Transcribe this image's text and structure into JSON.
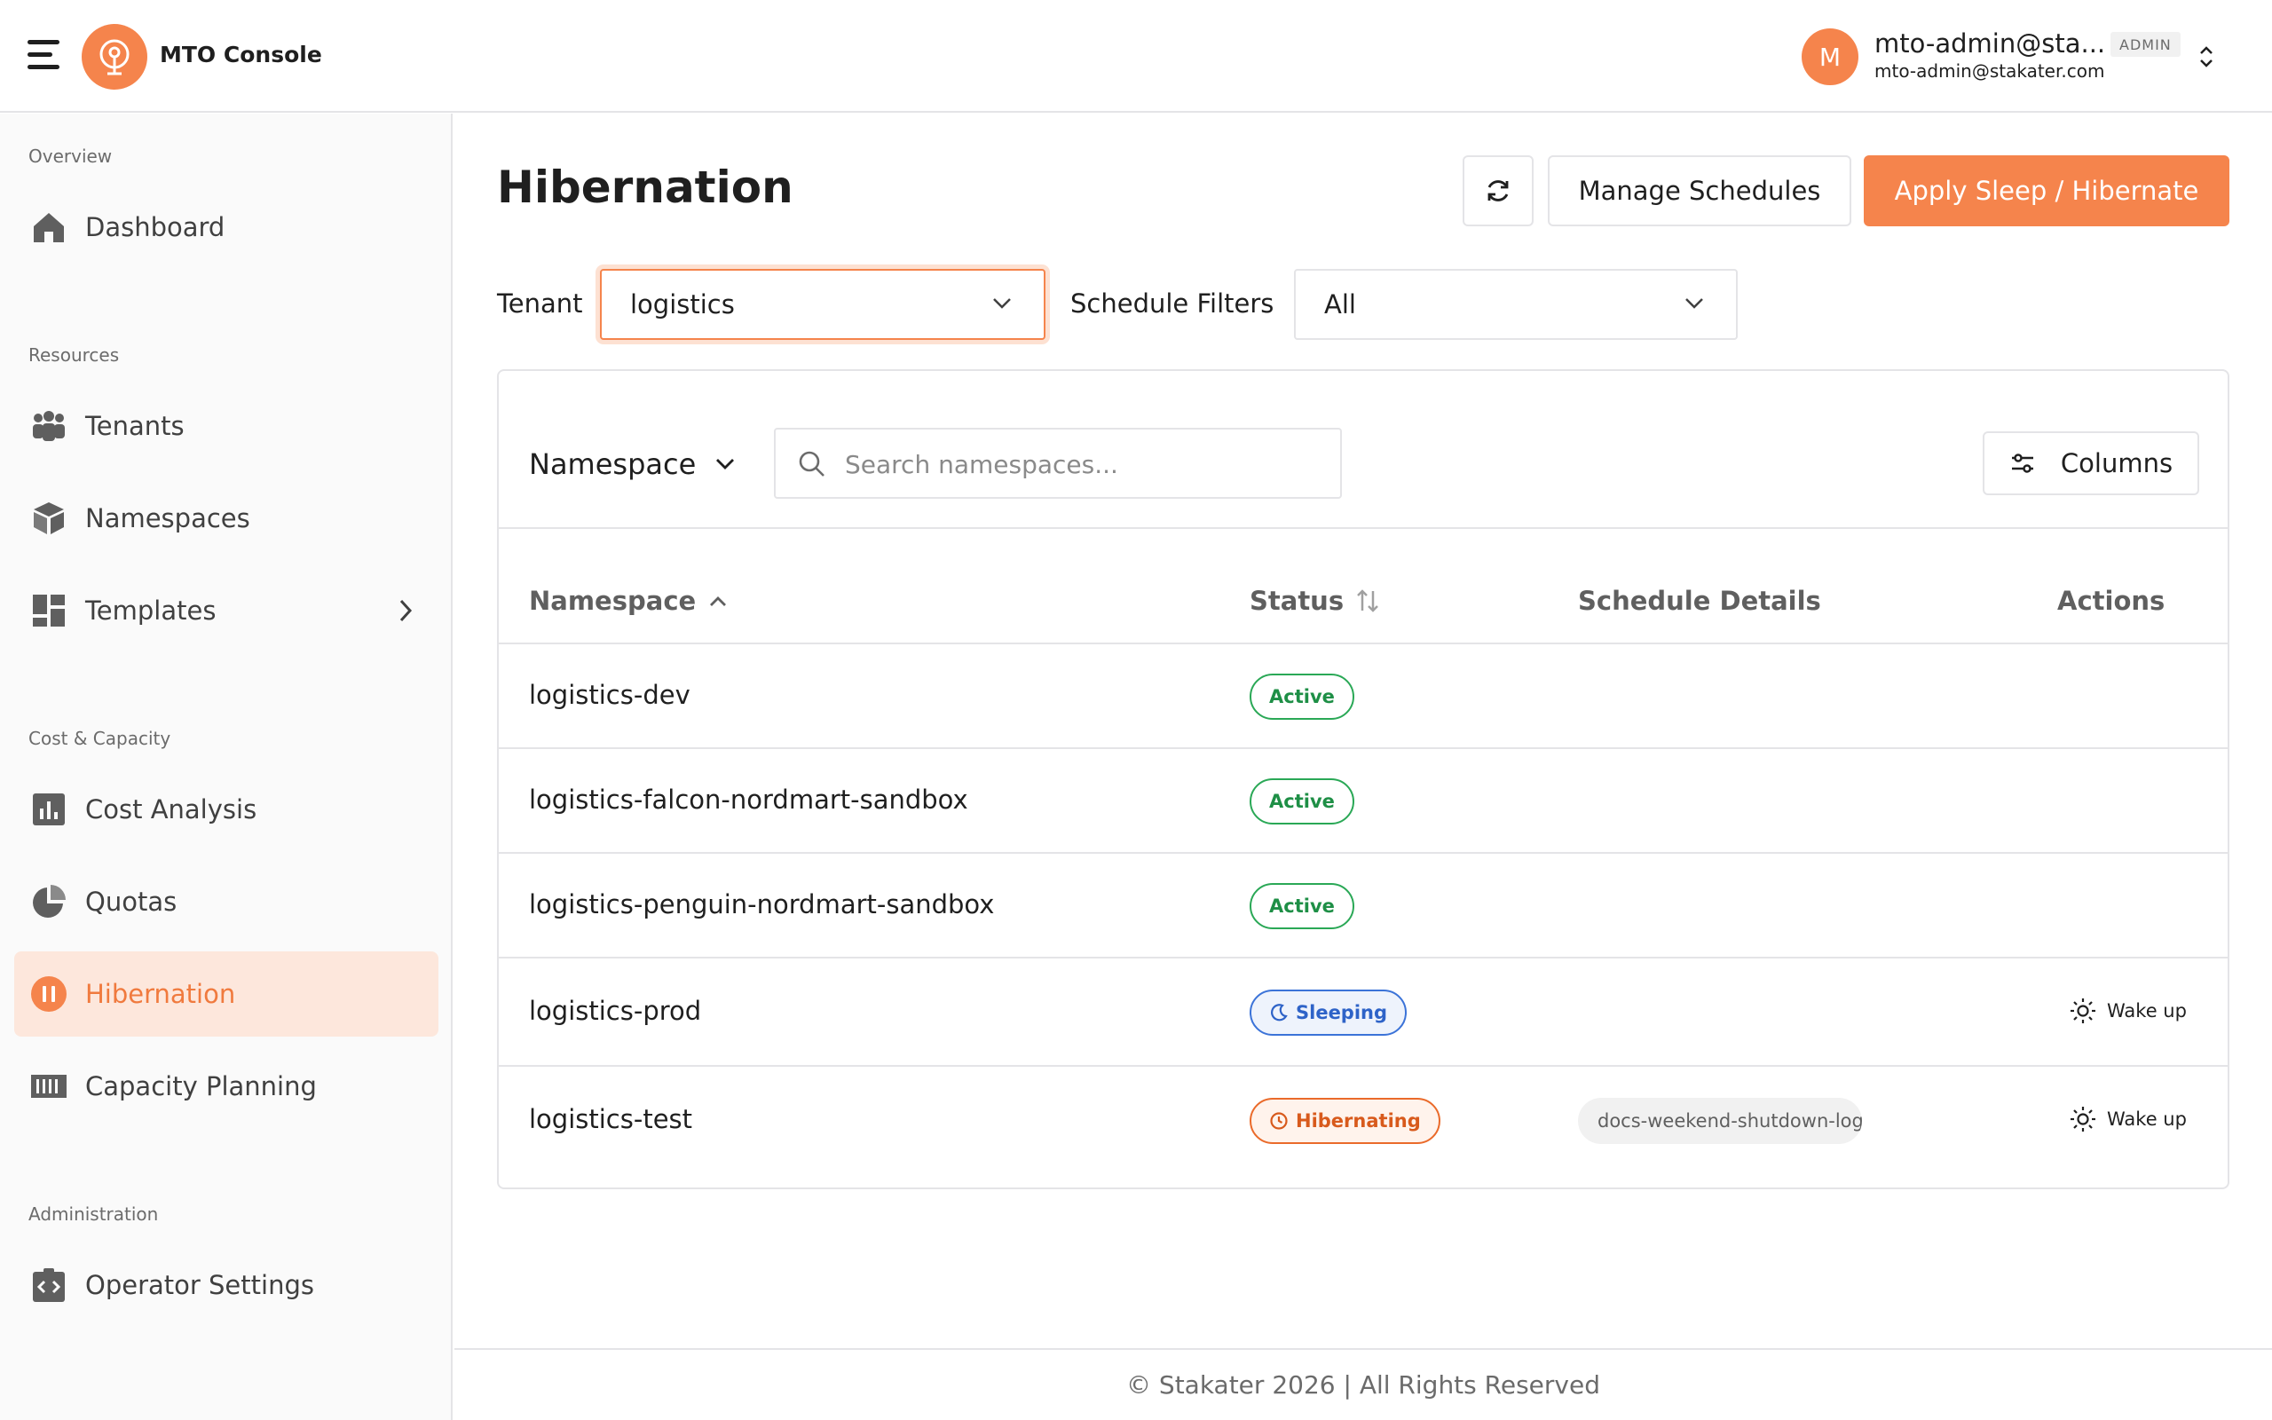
{
  "header": {
    "app_title": "MTO Console",
    "user": {
      "avatar_letter": "M",
      "name": "mto-admin@sta...",
      "email": "mto-admin@stakater.com",
      "role_badge": "ADMIN"
    }
  },
  "sidebar": {
    "sections": {
      "overview": "Overview",
      "resources": "Resources",
      "cost_capacity": "Cost & Capacity",
      "administration": "Administration"
    },
    "items": {
      "dashboard": "Dashboard",
      "tenants": "Tenants",
      "namespaces": "Namespaces",
      "templates": "Templates",
      "cost_analysis": "Cost Analysis",
      "quotas": "Quotas",
      "hibernation": "Hibernation",
      "capacity_planning": "Capacity Planning",
      "operator_settings": "Operator Settings"
    },
    "active_item": "hibernation"
  },
  "main": {
    "title": "Hibernation",
    "buttons": {
      "manage_schedules": "Manage Schedules",
      "apply": "Apply Sleep / Hibernate"
    },
    "filters": {
      "tenant_label": "Tenant",
      "tenant_value": "logistics",
      "schedule_label": "Schedule Filters",
      "schedule_value": "All"
    },
    "table": {
      "column_selector": "Namespace",
      "search_placeholder": "Search namespaces...",
      "columns_button": "Columns",
      "headers": {
        "namespace": "Namespace",
        "status": "Status",
        "schedule": "Schedule Details",
        "actions": "Actions"
      },
      "rows": [
        {
          "namespace": "logistics-dev",
          "status": "Active",
          "schedule": "",
          "action": ""
        },
        {
          "namespace": "logistics-falcon-nordmart-sandbox",
          "status": "Active",
          "schedule": "",
          "action": ""
        },
        {
          "namespace": "logistics-penguin-nordmart-sandbox",
          "status": "Active",
          "schedule": "",
          "action": ""
        },
        {
          "namespace": "logistics-prod",
          "status": "Sleeping",
          "schedule": "",
          "action": "Wake up"
        },
        {
          "namespace": "logistics-test",
          "status": "Hibernating",
          "schedule": "docs-weekend-shutdown-logistics",
          "action": "Wake up"
        }
      ]
    }
  },
  "footer": {
    "text": "© Stakater 2026 | All Rights Reserved"
  },
  "colors": {
    "accent": "#f5844c",
    "active_green": "#1e8f46",
    "sleeping_blue": "#2e63c8",
    "hibernating_orange": "#d85a1c"
  }
}
